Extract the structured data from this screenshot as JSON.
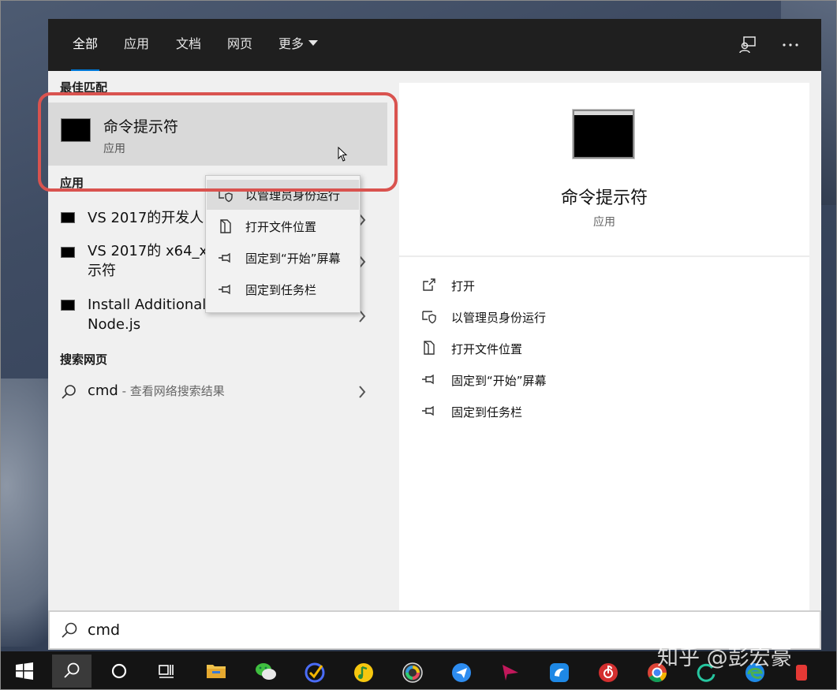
{
  "tabs": [
    {
      "label": "全部"
    },
    {
      "label": "应用"
    },
    {
      "label": "文档"
    },
    {
      "label": "网页"
    },
    {
      "label": "更多"
    }
  ],
  "left": {
    "best_match_header": "最佳匹配",
    "best_match": {
      "name": "命令提示符",
      "type": "应用"
    },
    "apps_header": "应用",
    "apps": [
      {
        "label": "VS 2017的开发人"
      },
      {
        "label_line1": "VS 2017的 x64_x",
        "label_line2": "示符"
      },
      {
        "label_line1": "Install Additional Tools for",
        "label_line2": "Node.js"
      }
    ],
    "web_header": "搜索网页",
    "web_result": {
      "query": "cmd",
      "suffix": " - 查看网络搜索结果"
    }
  },
  "context_menu": [
    {
      "label": "以管理员身份运行",
      "icon": "shield-icon"
    },
    {
      "label": "打开文件位置",
      "icon": "file-location-icon"
    },
    {
      "label": "固定到“开始”屏幕",
      "icon": "pin-icon"
    },
    {
      "label": "固定到任务栏",
      "icon": "pin-icon"
    }
  ],
  "preview": {
    "title": "命令提示符",
    "subtitle": "应用",
    "actions": [
      {
        "label": "打开",
        "icon": "open-icon"
      },
      {
        "label": "以管理员身份运行",
        "icon": "shield-icon"
      },
      {
        "label": "打开文件位置",
        "icon": "file-location-icon"
      },
      {
        "label": "固定到“开始”屏幕",
        "icon": "pin-icon"
      },
      {
        "label": "固定到任务栏",
        "icon": "pin-icon"
      }
    ]
  },
  "search": {
    "value": "cmd"
  },
  "watermark": "知乎 @彭宏豪",
  "colors": {
    "accent": "#0078d7",
    "highlight": "#d9534f",
    "topbar": "#1f1f1f"
  }
}
